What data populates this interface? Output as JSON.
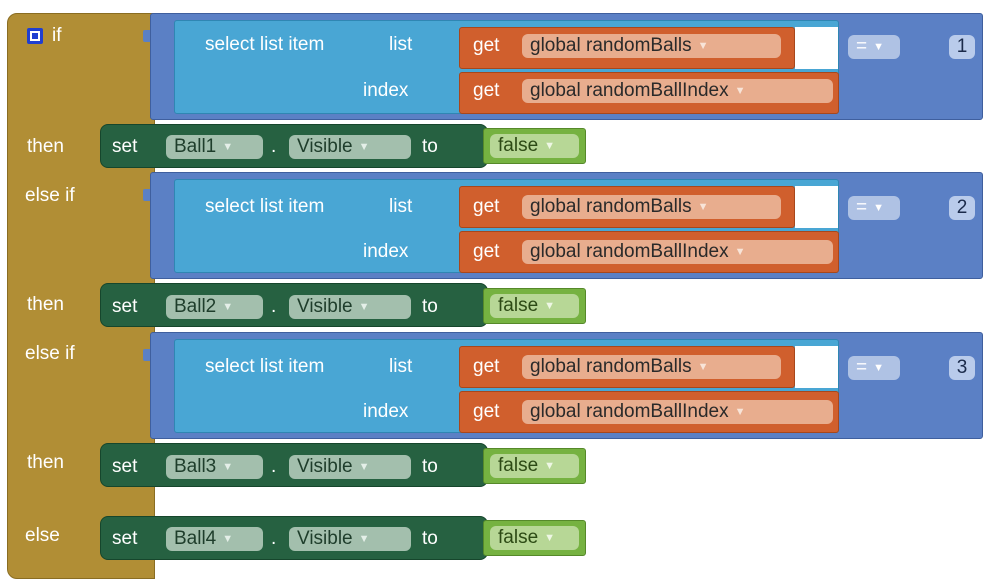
{
  "controls": {
    "if_label": "if",
    "then_label": "then",
    "else_if_label": "else if",
    "else_label": "else"
  },
  "list_block": {
    "select_label": "select list item",
    "list_label": "list",
    "index_label": "index"
  },
  "getters": {
    "get_label": "get",
    "list_var": "global randomBalls",
    "index_var": "global randomBallIndex"
  },
  "compare": {
    "operator": "="
  },
  "conditions": [
    {
      "value": "1"
    },
    {
      "value": "2"
    },
    {
      "value": "3"
    }
  ],
  "setter": {
    "set_label": "set",
    "dot": ".",
    "property": "Visible",
    "to_label": "to",
    "value": "false"
  },
  "targets": [
    "Ball1",
    "Ball2",
    "Ball3",
    "Ball4"
  ],
  "colors": {
    "control": "#b18e35",
    "compare": "#5b80c5",
    "list": "#49a6d4",
    "getter": "#d05f2d",
    "setter": "#266141",
    "boolean": "#76b241"
  }
}
